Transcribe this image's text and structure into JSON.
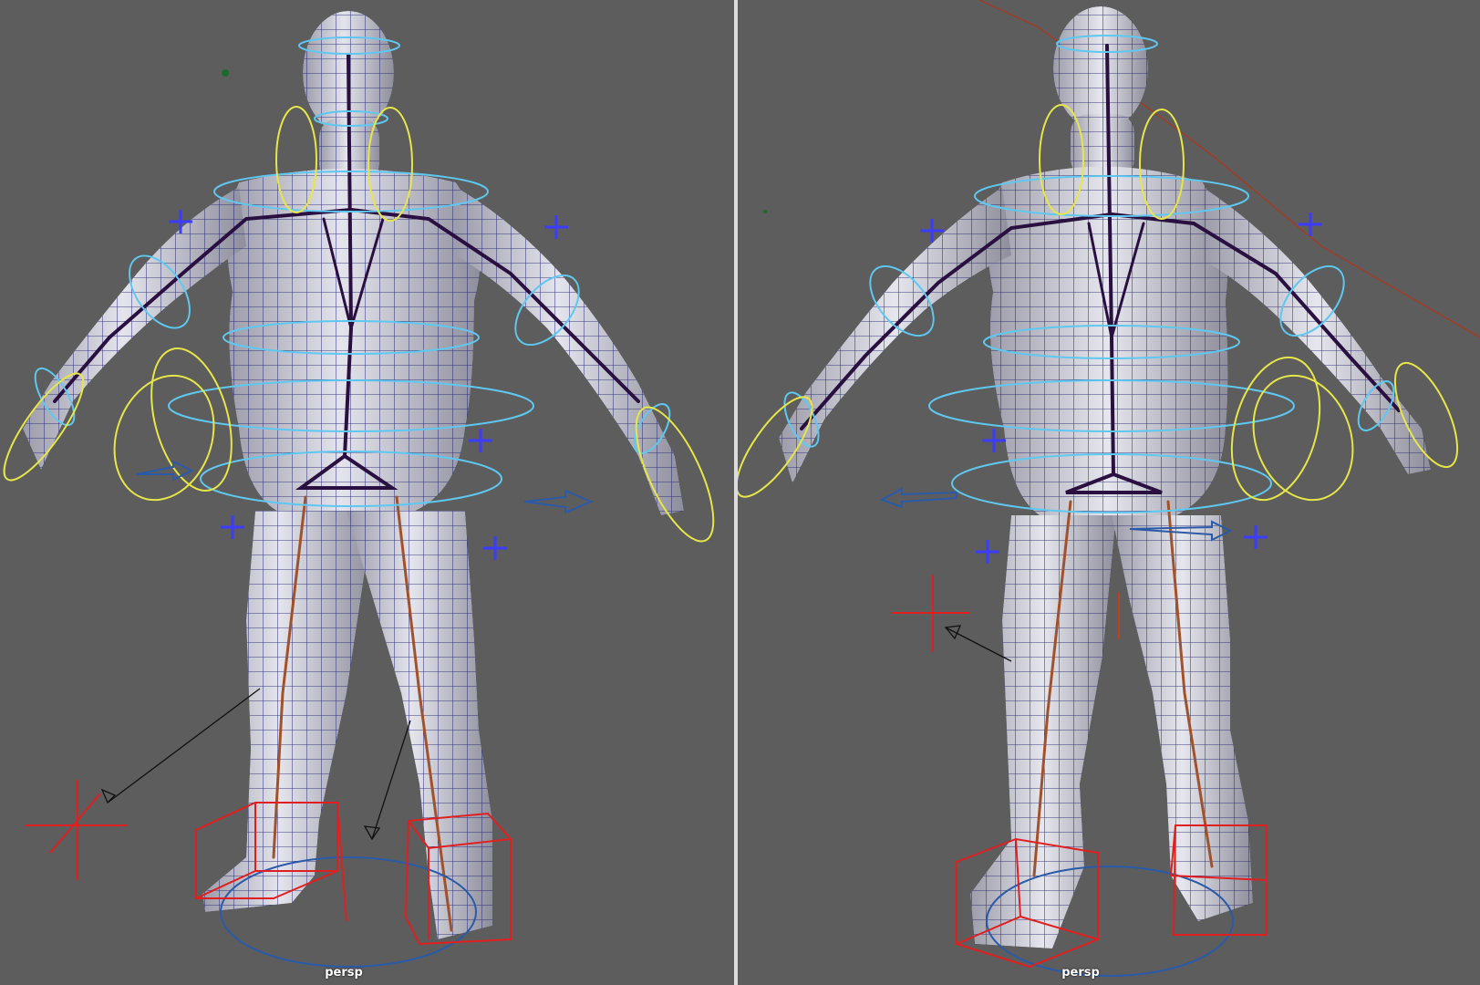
{
  "viewports": {
    "left": {
      "camera_label": "persp"
    },
    "right": {
      "camera_label": "persp"
    }
  },
  "colors": {
    "background": "#5d5d5d",
    "mesh_fill": "#c9c9d2",
    "wireframe": "#1c1c6e",
    "joint_spine": "#2a1040",
    "joint_leg": "#a0522d",
    "ctrl_cyan": "#5ec8f0",
    "ctrl_yellow": "#e6e64a",
    "ctrl_blue": "#3c3cff",
    "ik_red": "#e02020",
    "pole_line": "#111111",
    "divider": "#dcdcdc"
  },
  "icons": {
    "pole_vector": "cross-locator-icon",
    "ik_foot": "foot-box-control-icon",
    "fk_axis": "plus-locator-icon"
  }
}
